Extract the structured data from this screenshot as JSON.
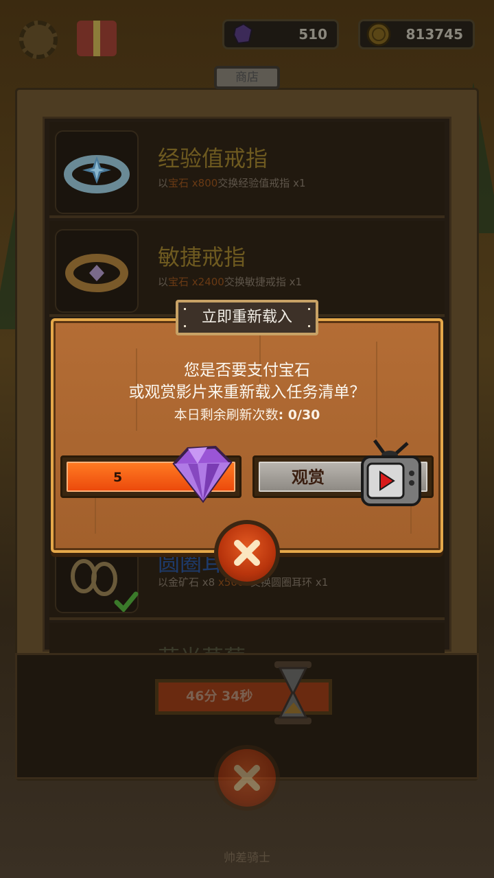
{
  "topbar": {
    "gems": "510",
    "coins": "813745"
  },
  "shop": {
    "tab_label": "商店",
    "items": [
      {
        "title": "经验值戒指",
        "desc_pre": "以",
        "desc_hl": "宝石 x800",
        "desc_post": "交换经验值戒指 x1",
        "icon": "silver-ring-icon"
      },
      {
        "title": "敏捷戒指",
        "desc_pre": "以",
        "desc_hl": "宝石 x2400",
        "desc_post": "交换敏捷戒指 x1",
        "icon": "gold-ring-icon"
      },
      {
        "title": "圆圈耳环",
        "desc_pre": "以金矿石 x8",
        "desc_hl": "x5000",
        "desc_post": "交换圆圈耳环 x1",
        "icon": "hoop-earrings-icon"
      },
      {
        "title": "荧光草莓",
        "icon": "glow-icon"
      }
    ],
    "timer": "46分 34秒"
  },
  "dialog": {
    "title": "立即重新载入",
    "message_line1": "您是否要支付宝石",
    "message_line2": "或观赏影片来重新载入任务清单？",
    "refresh_label": "本日剩余刷新次数",
    "refresh_count": ": 0/30",
    "pay_value": "5",
    "watch_label": "观赏"
  },
  "footer_text": "帅差骑士",
  "colors": {
    "dialog_wood": "#a2602c",
    "dialog_border": "#e5a84a",
    "pay_orange": "#ec4a0c",
    "gem_purple": "#9a55d6",
    "close_red": "#c8400f"
  }
}
